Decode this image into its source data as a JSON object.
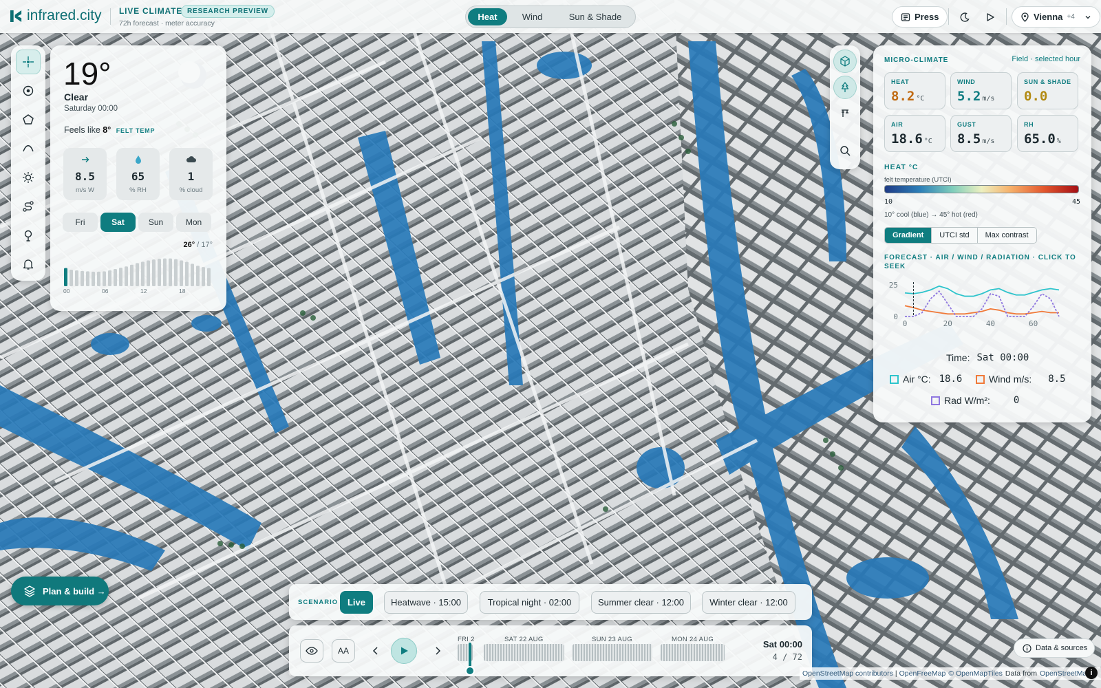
{
  "app": {
    "logo_text": "infrared.city",
    "title": "LIVE CLIMATE",
    "badge": "RESEARCH PREVIEW",
    "subtitle": "72h forecast · meter accuracy"
  },
  "modes": [
    {
      "label": "Heat",
      "active": true
    },
    {
      "label": "Wind",
      "active": false
    },
    {
      "label": "Sun & Shade",
      "active": false
    }
  ],
  "topright": {
    "press": "Press",
    "location": "Vienna",
    "location_extra": "+4"
  },
  "weather": {
    "temp": "19°",
    "condition": "Clear",
    "date": "Saturday 00:00",
    "feels_prefix": "Feels like",
    "feels_value": "8°",
    "felt_tag": "FELT TEMP",
    "stats": [
      {
        "value": "8.5",
        "unit": "m/s W",
        "icon": "arrow-right-icon"
      },
      {
        "value": "65",
        "unit": "% RH",
        "icon": "droplet-icon"
      },
      {
        "value": "1",
        "unit": "% cloud",
        "icon": "cloud-icon"
      }
    ],
    "days": [
      {
        "label": "Fri",
        "active": false
      },
      {
        "label": "Sat",
        "active": true
      },
      {
        "label": "Sun",
        "active": false
      },
      {
        "label": "Mon",
        "active": false
      }
    ],
    "high": "26°",
    "low": "/ 17°",
    "hour_ticks": [
      "00",
      "06",
      "12",
      "18"
    ],
    "hourly_levels": [
      0.55,
      0.5,
      0.48,
      0.46,
      0.45,
      0.44,
      0.44,
      0.45,
      0.48,
      0.52,
      0.56,
      0.6,
      0.65,
      0.7,
      0.74,
      0.78,
      0.81,
      0.83,
      0.84,
      0.84,
      0.82,
      0.78,
      0.74,
      0.68,
      0.62,
      0.58,
      0.55
    ]
  },
  "micro": {
    "title": "MICRO-CLIMATE",
    "note": "Field · selected hour",
    "cards": [
      {
        "label": "HEAT",
        "value": "8.2",
        "unit": "°C",
        "color": "#c06a12"
      },
      {
        "label": "WIND",
        "value": "5.2",
        "unit": "m/s",
        "color": "#127d82"
      },
      {
        "label": "SUN & SHADE",
        "value": "0.0",
        "unit": "",
        "color": "#b28a12"
      },
      {
        "label": "AIR",
        "value": "18.6",
        "unit": "°C",
        "color": "#111111"
      },
      {
        "label": "GUST",
        "value": "8.5",
        "unit": "m/s",
        "color": "#111111"
      },
      {
        "label": "RH",
        "value": "65.0",
        "unit": "%",
        "color": "#111111"
      }
    ],
    "scale_title": "HEAT °C",
    "scale_sub": "felt temperature (UTCI)",
    "scale_min": "10",
    "scale_max": "45",
    "scale_desc": "10° cool (blue) → 45° hot (red)",
    "scale_modes": [
      {
        "label": "Gradient",
        "active": true
      },
      {
        "label": "UTCI std",
        "active": false
      },
      {
        "label": "Max contrast",
        "active": false
      }
    ],
    "forecast_title": "FORECAST · AIR / WIND / RADIATION · CLICK TO SEEK",
    "time_label": "Time:",
    "time_value": "Sat 00:00",
    "legend": [
      {
        "name": "Air °C:",
        "value": "18.6",
        "color": "#2ec4cc"
      },
      {
        "name": "Wind m/s:",
        "value": "8.5",
        "color": "#f07a3a"
      },
      {
        "name": "Rad W/m²:",
        "value": "0",
        "color": "#8f77e0"
      }
    ]
  },
  "chart_data": {
    "type": "line",
    "title": "",
    "xlabel": "",
    "ylabel": "",
    "xlim": [
      0,
      72
    ],
    "ylim": [
      0,
      25
    ],
    "x_ticks": [
      "0",
      "20",
      "40",
      "60"
    ],
    "y_ticks": [
      "0",
      "25"
    ],
    "x": [
      0,
      4,
      8,
      12,
      16,
      20,
      24,
      28,
      32,
      36,
      40,
      44,
      48,
      52,
      56,
      60,
      64,
      68,
      72
    ],
    "series": [
      {
        "name": "Air °C",
        "color": "#2ec4cc",
        "values": [
          18.6,
          18,
          19,
          21,
          24,
          22,
          18,
          16,
          16,
          18,
          21,
          22,
          19,
          17,
          17,
          19,
          21,
          22,
          21
        ]
      },
      {
        "name": "Wind m/s",
        "color": "#f07a3a",
        "values": [
          8.5,
          7,
          5,
          4,
          3,
          2,
          2,
          2,
          3,
          4,
          6,
          5,
          3,
          2,
          2,
          3,
          4,
          3,
          3
        ]
      },
      {
        "name": "Rad W/m²",
        "color": "#8f77e0",
        "values": [
          0,
          0,
          3,
          14,
          20,
          10,
          0,
          0,
          0,
          6,
          18,
          16,
          0,
          0,
          0,
          8,
          18,
          14,
          0
        ]
      }
    ]
  },
  "scenario": {
    "label": "SCENARIO",
    "options": [
      {
        "label": "Live",
        "active": true
      },
      {
        "label": "Heatwave · 15:00",
        "active": false
      },
      {
        "label": "Tropical night · 02:00",
        "active": false
      },
      {
        "label": "Summer clear · 12:00",
        "active": false
      },
      {
        "label": "Winter clear · 12:00",
        "active": false
      }
    ]
  },
  "timeline": {
    "days": [
      "FRI 2",
      "SAT 22 AUG",
      "SUN 23 AUG",
      "MON 24 AUG"
    ],
    "current_time": "Sat 00:00",
    "index": "4",
    "total": "72",
    "aa_label": "AA"
  },
  "plan_build": "Plan & build →",
  "data_sources": "Data & sources",
  "attribution": {
    "prefix": "OpenStreetMap contributors",
    "sep1": "|",
    "ofm": "OpenFreeMap",
    "omt": "© OpenMapTiles",
    "data_from": "Data from",
    "osm": "OpenStreetMap"
  },
  "info_glyph": "i"
}
